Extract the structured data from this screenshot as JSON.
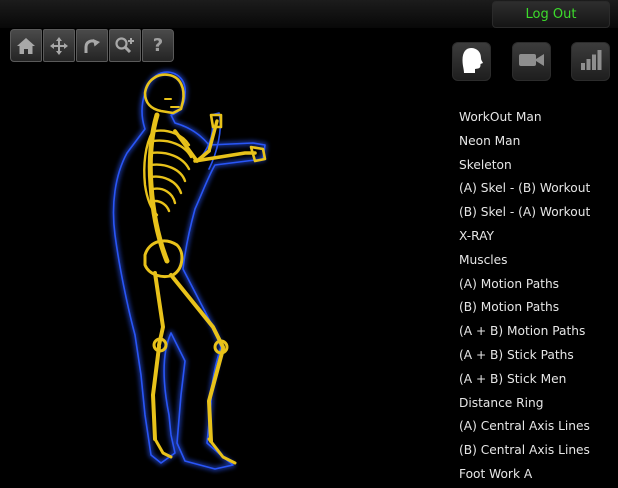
{
  "header": {
    "logout_label": "Log Out"
  },
  "toolbar": {
    "tools": [
      {
        "name": "home",
        "icon": "home-icon"
      },
      {
        "name": "move",
        "icon": "move-arrows-icon"
      },
      {
        "name": "rotate",
        "icon": "rotate-arrow-icon"
      },
      {
        "name": "zoom",
        "icon": "zoom-icon"
      },
      {
        "name": "help",
        "icon": "help-icon",
        "label": "?"
      }
    ]
  },
  "view_buttons": [
    {
      "name": "head",
      "icon": "head-profile-icon"
    },
    {
      "name": "camera",
      "icon": "video-camera-icon"
    },
    {
      "name": "signal",
      "icon": "signal-bars-icon"
    }
  ],
  "menu": {
    "items": [
      "WorkOut Man",
      "Neon Man",
      "Skeleton",
      "(A) Skel - (B) Workout",
      "(B) Skel - (A) Workout",
      "X-RAY",
      "Muscles",
      "(A) Motion Paths",
      "(B) Motion Paths",
      "(A + B) Motion Paths",
      "(A + B) Stick Paths",
      "(A + B) Stick Men",
      "Distance Ring",
      "(A) Central Axis Lines",
      "(B) Central Axis Lines",
      "Foot Work A"
    ]
  },
  "colors": {
    "logout_text": "#3ddc2c",
    "bone": "#e8c21a",
    "body_glow": "#2b59ff",
    "background": "#000000"
  }
}
